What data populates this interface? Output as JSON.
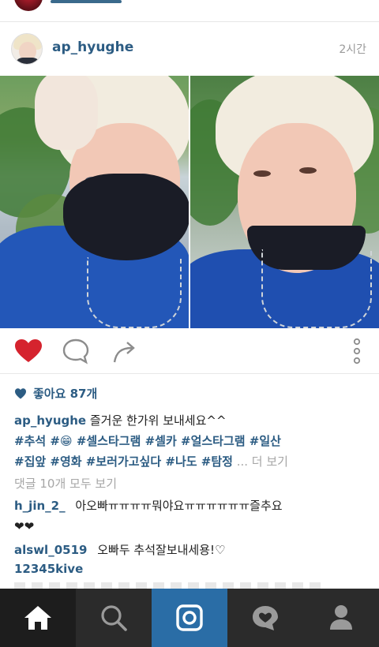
{
  "post": {
    "username": "ap_hyughe",
    "timestamp": "2시간",
    "likes_label": "좋아요 87개",
    "caption_user": "ap_hyughe",
    "caption_text": "즐거운 한가위 보내세요^^",
    "hashtags_line1": "#추석 #😁 #셀스타그램 #셀카 #얼스타그램 #일산",
    "hashtags_line2": "#집앞 #영화 #보러가고싶다 #나도 #탐정",
    "more_label": "... 더 보기",
    "view_comments": "댓글 10개 모두 보기"
  },
  "comments": [
    {
      "user": "h_jin_2_",
      "text": "아오빠ㅠㅠㅠㅠ뭐야요ㅠㅠㅠㅠㅠㅠ즐추요",
      "extra": "❤❤"
    },
    {
      "user": "alswl_0519",
      "text": "오빠두 추석잘보내세용!♡"
    },
    {
      "user": "12345kive",
      "text": ""
    }
  ],
  "icons": {
    "like": "heart-filled-icon",
    "comment": "speech-bubble-icon",
    "share": "share-arrow-icon",
    "more": "vertical-dots-icon",
    "tabs": [
      "home-icon",
      "search-icon",
      "camera-icon",
      "activity-heart-icon",
      "profile-icon"
    ]
  },
  "colors": {
    "like_red": "#d5232e",
    "link_blue": "#2c5c83",
    "tabbar": "#2b2b2b",
    "camera_tab": "#2a6da6"
  }
}
